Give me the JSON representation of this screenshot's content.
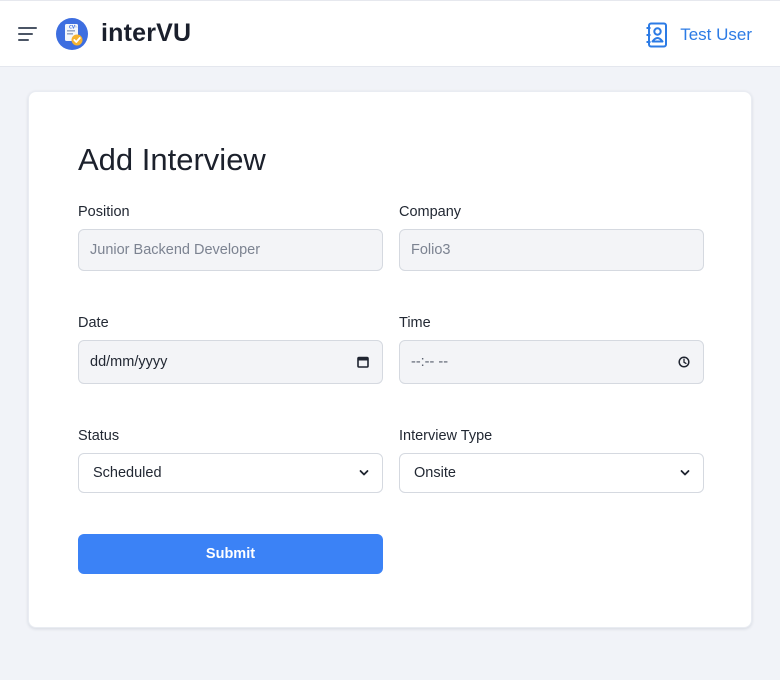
{
  "header": {
    "brand": "interVU",
    "logo_badge": "CV",
    "user_name": "Test User",
    "accent_color": "#2c7be5"
  },
  "form": {
    "title": "Add Interview",
    "position": {
      "label": "Position",
      "placeholder": "Junior Backend Developer"
    },
    "company": {
      "label": "Company",
      "placeholder": "Folio3"
    },
    "date": {
      "label": "Date",
      "placeholder": "dd/mm/yyyy"
    },
    "time": {
      "label": "Time",
      "placeholder": "--:-- --"
    },
    "status": {
      "label": "Status",
      "selected": "Scheduled"
    },
    "interview_type": {
      "label": "Interview Type",
      "selected": "Onsite"
    },
    "submit_label": "Submit",
    "submit_color": "#3b82f6"
  },
  "icons": {
    "menu": "hamburger-menu-icon",
    "logo": "cv-document-check-icon",
    "user": "contact-book-icon",
    "date": "calendar-icon",
    "time": "clock-icon",
    "select": "chevron-down-icon"
  }
}
